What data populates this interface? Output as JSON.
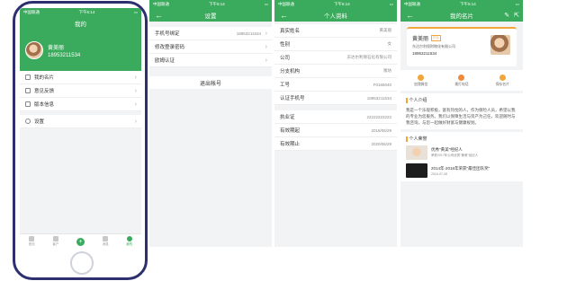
{
  "status": {
    "carrier": "中国联通",
    "time": "下午5:14"
  },
  "screen_mine": {
    "title": "我的",
    "name": "黄美丽",
    "phone": "18953211534",
    "menu": [
      "我的名片",
      "意见反馈",
      "版本信息"
    ],
    "settings_label": "设置",
    "tabs": [
      "首页",
      "客户",
      "",
      "消息",
      "我的"
    ]
  },
  "screen_settings": {
    "title": "设置",
    "rows": [
      {
        "label": "手机号绑定",
        "value": "18953211534"
      },
      {
        "label": "修改登录密码",
        "value": ""
      },
      {
        "label": "欧姆认证",
        "value": ""
      }
    ],
    "logout": "退出帐号"
  },
  "screen_profile": {
    "title": "个人资料",
    "rows": [
      {
        "label": "真实姓名",
        "value": "黄美丽"
      },
      {
        "label": "性别",
        "value": "女"
      },
      {
        "label": "公司",
        "value": "东达尔利保石化有限公司"
      },
      {
        "label": "分支机构",
        "value": "潍坊"
      },
      {
        "label": "工号",
        "value": "F0166040"
      },
      {
        "label": "认证手机号",
        "value": "18953211534"
      }
    ],
    "rows2": [
      {
        "label": "执业证",
        "value": "22222222222"
      },
      {
        "label": "有效期起",
        "value": "2018/06/29"
      },
      {
        "label": "有效期止",
        "value": "2020/06/29"
      }
    ]
  },
  "screen_card": {
    "title": "我的名片",
    "name": "黄美丽",
    "tag": "已认",
    "company": "东达尔利保财物化有限公司",
    "phone": "18953211534",
    "actions": [
      "加我微信",
      "拨打电话",
      "保存名片"
    ],
    "intro_title": "个人介绍",
    "intro_text": "我是一个乐观积极，富有热忱的人，作为保险人员，希望以我的专业为您服务。我们以保障生活与资产为己任，欢迎随时与我咨询，与您一起做好财富与健康规划。",
    "honor_title": "个人荣誉",
    "honors": [
      {
        "title": "优秀\"黄美\"经纪人",
        "sub": "荣获2017年公司优秀\"黄美\"经纪人"
      },
      {
        "title": "2014年-2016年荣获\"最佳团队奖\"",
        "sub": "2016-07-08"
      }
    ]
  },
  "colors": {
    "primary": "#3aaa5c",
    "accent": "#f0a63a",
    "frame": "#2d2f6e"
  }
}
